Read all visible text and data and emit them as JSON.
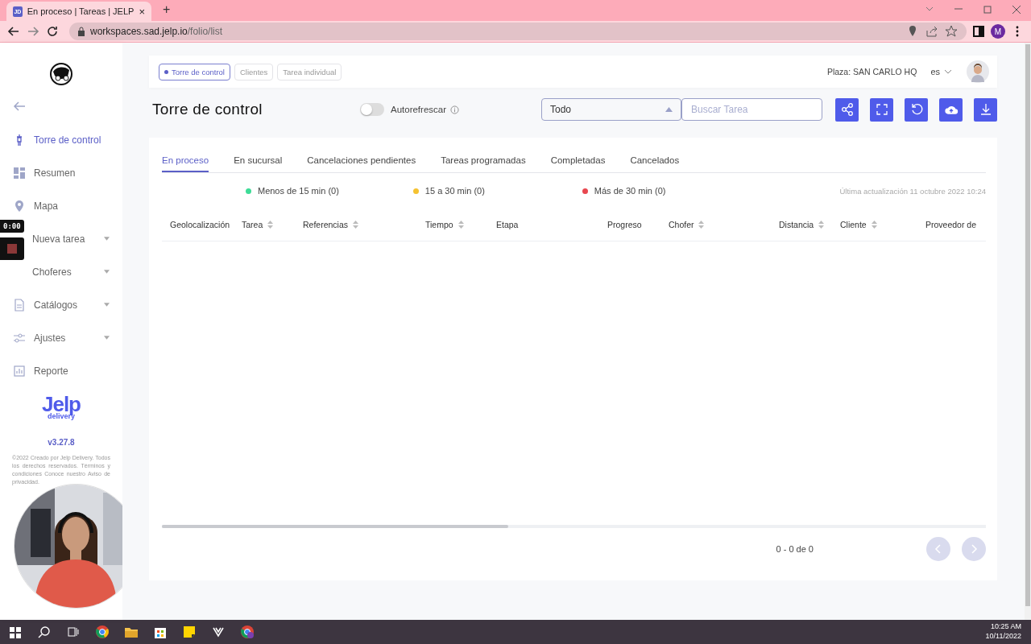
{
  "browser": {
    "tab_icon": "JD",
    "tab_title": "En proceso | Tareas | JELP",
    "url_host": "workspaces.sad.jelp.io",
    "url_path": "/folio/list",
    "profile": "M",
    "close_tab": "×",
    "new_tab": "+"
  },
  "sidebar": {
    "items": [
      {
        "label": "Torre de control",
        "selected": true,
        "expandable": false
      },
      {
        "label": "Resumen",
        "selected": false,
        "expandable": false
      },
      {
        "label": "Mapa",
        "selected": false,
        "expandable": false
      },
      {
        "label": "Nueva tarea",
        "selected": false,
        "expandable": true
      },
      {
        "label": "Choferes",
        "selected": false,
        "expandable": true
      },
      {
        "label": "Catálogos",
        "selected": false,
        "expandable": true
      },
      {
        "label": "Ajustes",
        "selected": false,
        "expandable": true
      },
      {
        "label": "Reporte",
        "selected": false,
        "expandable": false
      }
    ],
    "brand": "Jelp",
    "brand_sub": "delivery",
    "version": "v3.27.8",
    "legal": "©2022 Creado por Jelp Delivery. Todos los derechos reservados. Términos y condiciones Conoce nuestro Aviso de privacidad."
  },
  "recorder": {
    "time": "0:00"
  },
  "breadcrumbs": [
    {
      "label": "Torre de control",
      "selected": true
    },
    {
      "label": "Clientes",
      "selected": false
    },
    {
      "label": "Tarea individual",
      "selected": false
    }
  ],
  "plaza": "Plaza: SAN CARLO HQ",
  "language": "es",
  "title": "Torre de control",
  "autorefresh": {
    "label": "Autorefrescar",
    "on": false
  },
  "filter": {
    "value": "Todo"
  },
  "search": {
    "placeholder": "Buscar Tarea"
  },
  "tabs": [
    {
      "label": "En proceso",
      "selected": true
    },
    {
      "label": "En sucursal",
      "selected": false
    },
    {
      "label": "Cancelaciones pendientes",
      "selected": false
    },
    {
      "label": "Tareas programadas",
      "selected": false
    },
    {
      "label": "Completadas",
      "selected": false
    },
    {
      "label": "Cancelados",
      "selected": false
    }
  ],
  "legend": [
    {
      "label": "Menos de 15 min (0)",
      "color": "#3ddc97"
    },
    {
      "label": "15 a 30 min (0)",
      "color": "#f5c231"
    },
    {
      "label": "Más de 30 min (0)",
      "color": "#e8474f"
    }
  ],
  "last_update": "Última actualización 11 octubre 2022 10:24",
  "columns": [
    {
      "label": "Geolocalización",
      "sortable": false
    },
    {
      "label": "Tarea",
      "sortable": true
    },
    {
      "label": "Referencias",
      "sortable": true
    },
    {
      "label": "Tiempo",
      "sortable": true
    },
    {
      "label": "Etapa",
      "sortable": false
    },
    {
      "label": "Progreso",
      "sortable": false
    },
    {
      "label": "Chofer",
      "sortable": true
    },
    {
      "label": "Distancia",
      "sortable": true
    },
    {
      "label": "Cliente",
      "sortable": true
    },
    {
      "label": "Proveedor de",
      "sortable": false
    }
  ],
  "pagination": {
    "range": "0 - 0 de 0",
    "prev_disabled": true,
    "next_disabled": true
  },
  "taskbar": {
    "time": "10:25 AM",
    "date": "10/11/2022"
  }
}
